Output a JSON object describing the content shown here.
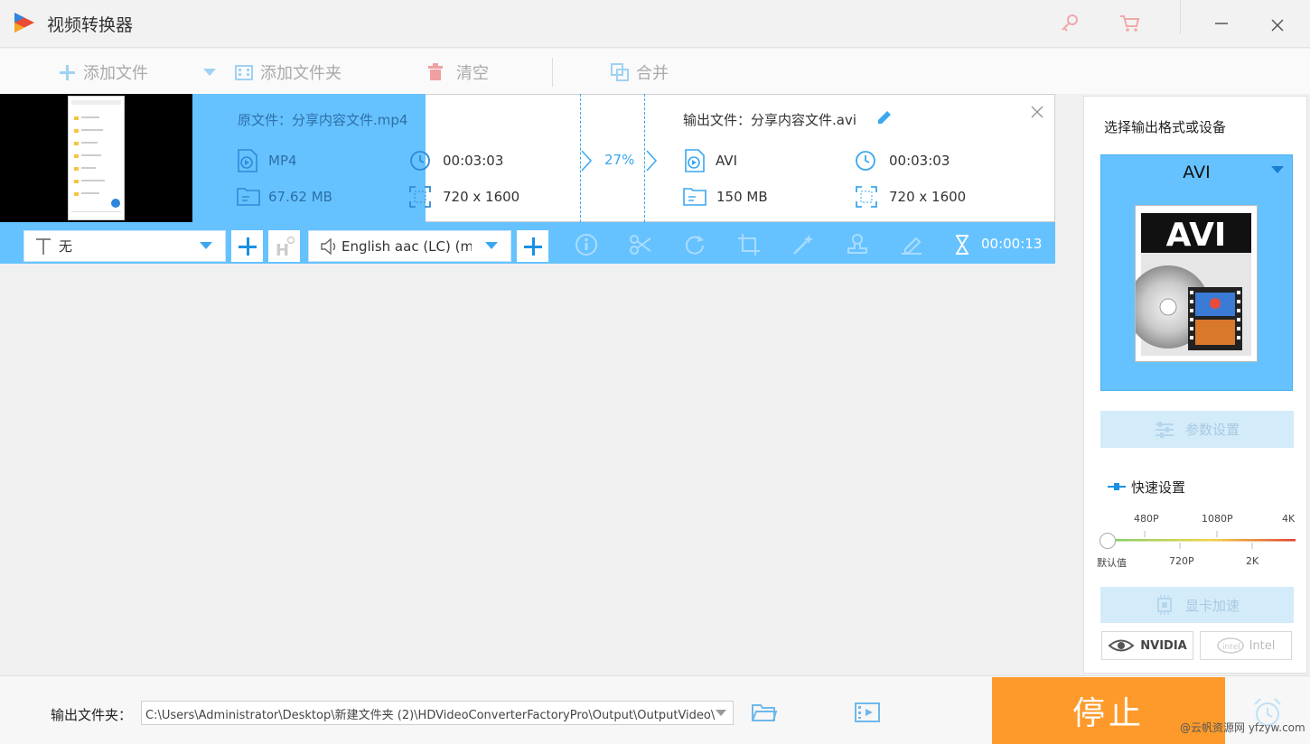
{
  "app": {
    "title": "视频转换器"
  },
  "toolbar": {
    "add_file": "添加文件",
    "add_folder": "添加文件夹",
    "clear": "清空",
    "merge": "合并"
  },
  "task": {
    "source": {
      "label": "原文件：",
      "file": "分享内容文件.mp4",
      "format": "MP4",
      "duration": "00:03:03",
      "size": "67.62 MB",
      "resolution": "720 x 1600"
    },
    "progress": "27%",
    "output": {
      "label": "输出文件：",
      "file": "分享内容文件.avi",
      "format": "AVI",
      "duration": "00:03:03",
      "size": "150 MB",
      "resolution": "720 x 1600"
    },
    "subtitle": "无",
    "audio": "English aac (LC) (mp",
    "elapsed": "00:00:13"
  },
  "right_panel": {
    "title": "选择输出格式或设备",
    "format": "AVI",
    "format_art_text": "AVI",
    "params_button": "参数设置",
    "quick_title": "快速设置",
    "ticks_top": [
      "480P",
      "1080P",
      "4K"
    ],
    "ticks_bottom": [
      "默认值",
      "720P",
      "2K"
    ],
    "gpu_button": "显卡加速",
    "vendors": [
      "NVIDIA",
      "Intel"
    ]
  },
  "bottom": {
    "output_label": "输出文件夹：",
    "output_path": "C:\\Users\\Administrator\\Desktop\\新建文件夹 (2)\\HDVideoConverterFactoryPro\\Output\\OutputVideo\\",
    "stop_button": "停止",
    "watermark": "@云帆资源网 yfzyw.com"
  },
  "colors": {
    "accent": "#3ba7ef",
    "panel_blue": "#65c2ff",
    "stop_orange": "#fe9a2b"
  }
}
